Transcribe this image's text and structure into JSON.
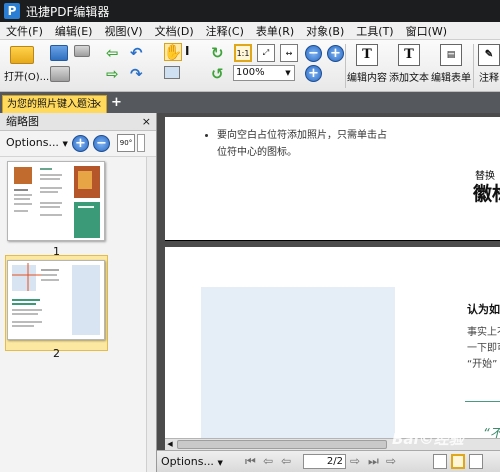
{
  "app": {
    "title": "迅捷PDF编辑器",
    "logo_letter": "P"
  },
  "menu": [
    "文件(F)",
    "编辑(E)",
    "视图(V)",
    "文档(D)",
    "注释(C)",
    "表单(R)",
    "对象(B)",
    "工具(T)",
    "窗口(W)"
  ],
  "toolbar": {
    "open_label": "打开(O)...",
    "zoom_value": "100%",
    "actual_size_label": "1:1",
    "edit_content_label": "编辑内容",
    "add_text_label": "添加文本",
    "edit_form_label": "编辑表单",
    "comment_label": "注释"
  },
  "tabs": {
    "doc_tab_label": "为您的照片键入题注",
    "new_tab": "+"
  },
  "thumbnail_panel": {
    "title": "缩略图",
    "options_label": "Options...",
    "rotate_label": "90°",
    "pages": [
      {
        "number": "1"
      },
      {
        "number": "2"
      }
    ],
    "selected_page": 2
  },
  "document": {
    "page1_bullet_lines": [
      "要向空白占位符添加照片，只需单击占",
      "位符中心的图标。"
    ],
    "page1_replace_small": "替换为",
    "page1_replace_big": "徽标",
    "page2_heading": "认为如",
    "page2_text_lines": [
      "事实上不",
      "一下即可",
      "“开始”"
    ],
    "page2_quote": "“不"
  },
  "status": {
    "options_label": "Options...",
    "page_value": "2",
    "page_total": "2"
  },
  "watermark": "Bai©经验"
}
